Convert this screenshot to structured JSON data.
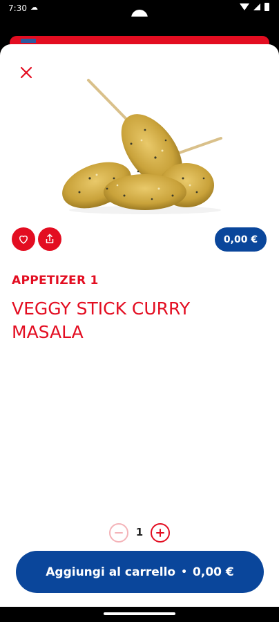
{
  "status_bar": {
    "time": "7:30",
    "cloud_icon": "cloud-icon",
    "wifi_icon": "wifi-icon",
    "signal_icon": "signal-icon",
    "battery_icon": "battery-icon"
  },
  "colors": {
    "brand_red": "#e30d21",
    "brand_blue": "#0a469b",
    "disabled_red": "#f4b3b8"
  },
  "product": {
    "price": "0,00 €",
    "category": "APPETIZER 1",
    "name": "VEGGY STICK CURRY MASALA",
    "image_icon": "veggy-stick-image"
  },
  "actions": {
    "close_icon": "close-icon",
    "favorite_icon": "heart-icon",
    "share_icon": "share-icon"
  },
  "quantity": {
    "value": "1",
    "minus_icon": "minus-icon",
    "plus_icon": "plus-icon"
  },
  "cart_button": {
    "label": "Aggiungi al carrello",
    "separator": "•",
    "total": "0,00 €"
  }
}
